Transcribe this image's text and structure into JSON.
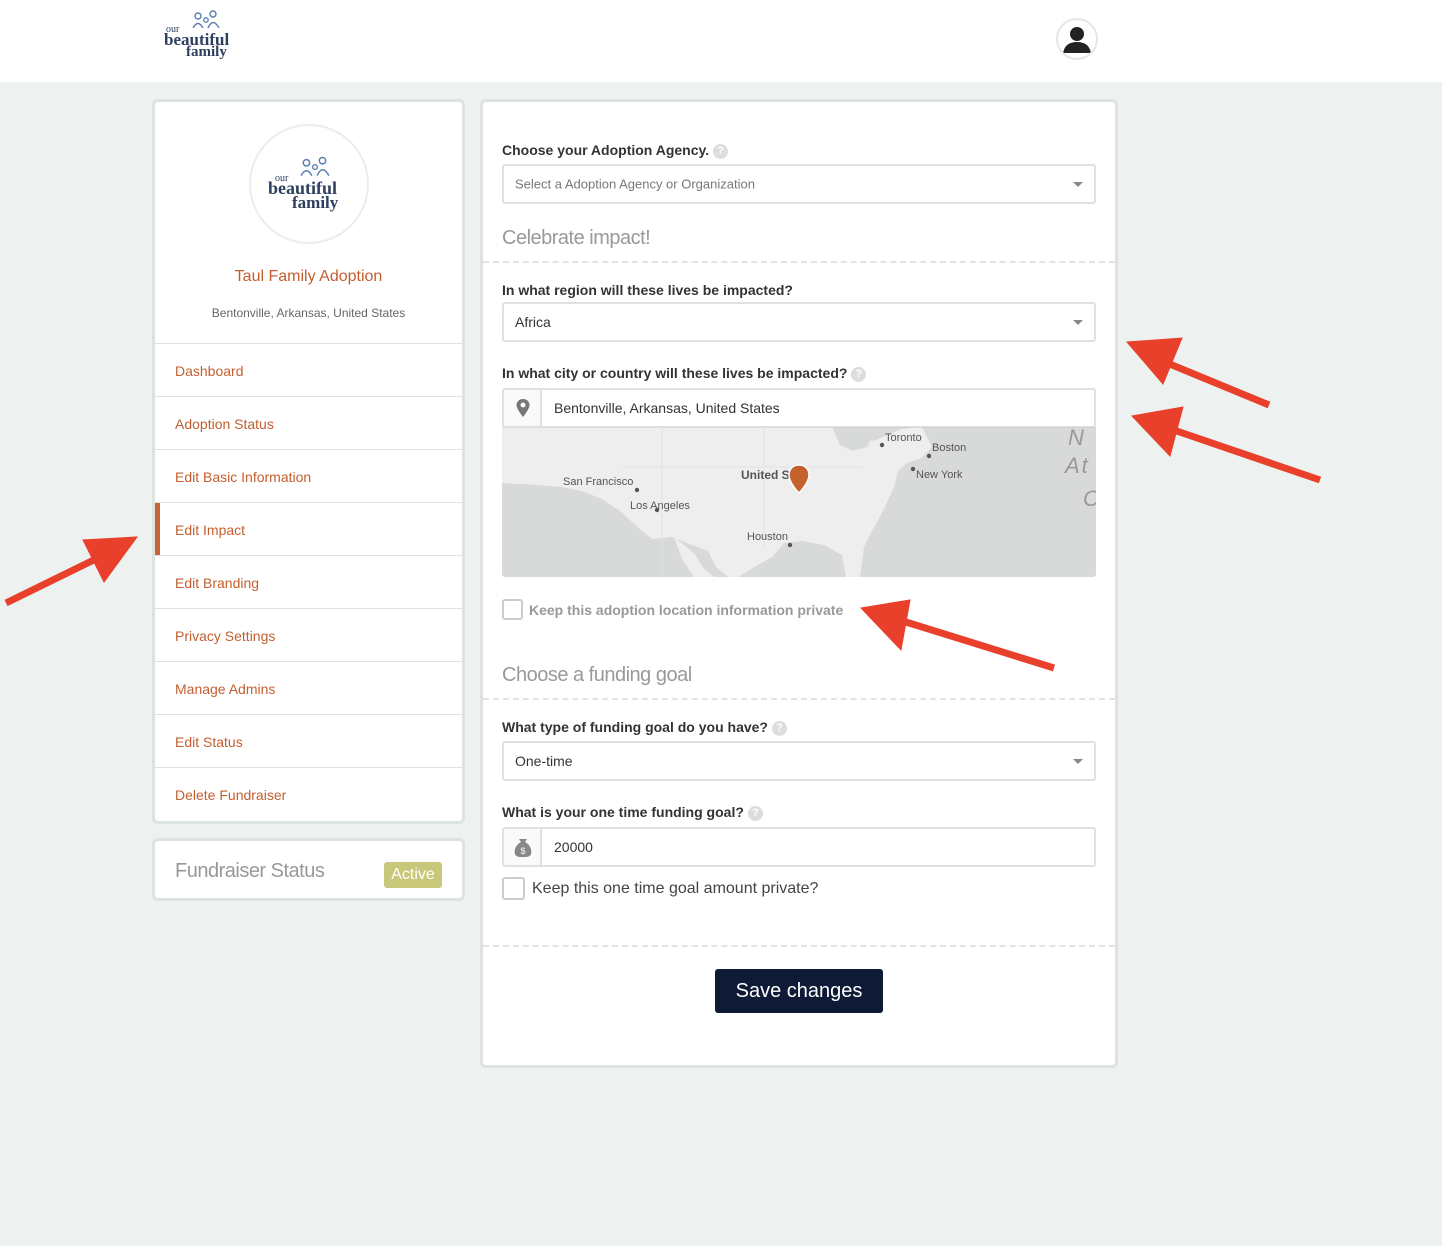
{
  "brand": {
    "logo_line1": "our",
    "logo_line2": "beautiful",
    "logo_line3": "family"
  },
  "sidebar": {
    "fundraiser_title": "Taul Family Adoption",
    "fundraiser_location": "Bentonville, Arkansas, United States",
    "nav": [
      {
        "label": "Dashboard",
        "active": false
      },
      {
        "label": "Adoption Status",
        "active": false
      },
      {
        "label": "Edit Basic Information",
        "active": false
      },
      {
        "label": "Edit Impact",
        "active": true
      },
      {
        "label": "Edit Branding",
        "active": false
      },
      {
        "label": "Privacy Settings",
        "active": false
      },
      {
        "label": "Manage Admins",
        "active": false
      },
      {
        "label": "Edit Status",
        "active": false
      },
      {
        "label": "Delete Fundraiser",
        "active": false
      }
    ],
    "status_label": "Fundraiser Status",
    "status_badge": "Active"
  },
  "form": {
    "agency_label": "Choose your Adoption Agency.",
    "agency_placeholder": "Select a Adoption Agency or Organization",
    "impact_section": "Celebrate impact!",
    "region_label": "In what region will these lives be impacted?",
    "region_value": "Africa",
    "city_label": "In what city or country will these lives be impacted?",
    "city_value": "Bentonville, Arkansas, United States",
    "map_labels": {
      "toronto": "Toronto",
      "boston": "Boston",
      "new_york": "New York",
      "united_states": "United S",
      "san_francisco": "San Francisco",
      "los_angeles": "Los Angeles",
      "houston": "Houston",
      "ocean_1": "N",
      "ocean_2": "At",
      "ocean_3": "O"
    },
    "location_private_label": "Keep this adoption location information private",
    "funding_section": "Choose a funding goal",
    "goal_type_label": "What type of funding goal do you have?",
    "goal_type_value": "One-time",
    "goal_amount_label": "What is your one time funding goal?",
    "goal_amount_value": "20000",
    "goal_private_label": "Keep this one time goal amount private?",
    "save_label": "Save changes",
    "help_glyph": "?"
  },
  "colors": {
    "accent": "#c35f2f",
    "navy": "#0e1a36",
    "badge": "#c9c77a",
    "arrow": "#e8402b",
    "page_bg": "#edf2f0"
  }
}
